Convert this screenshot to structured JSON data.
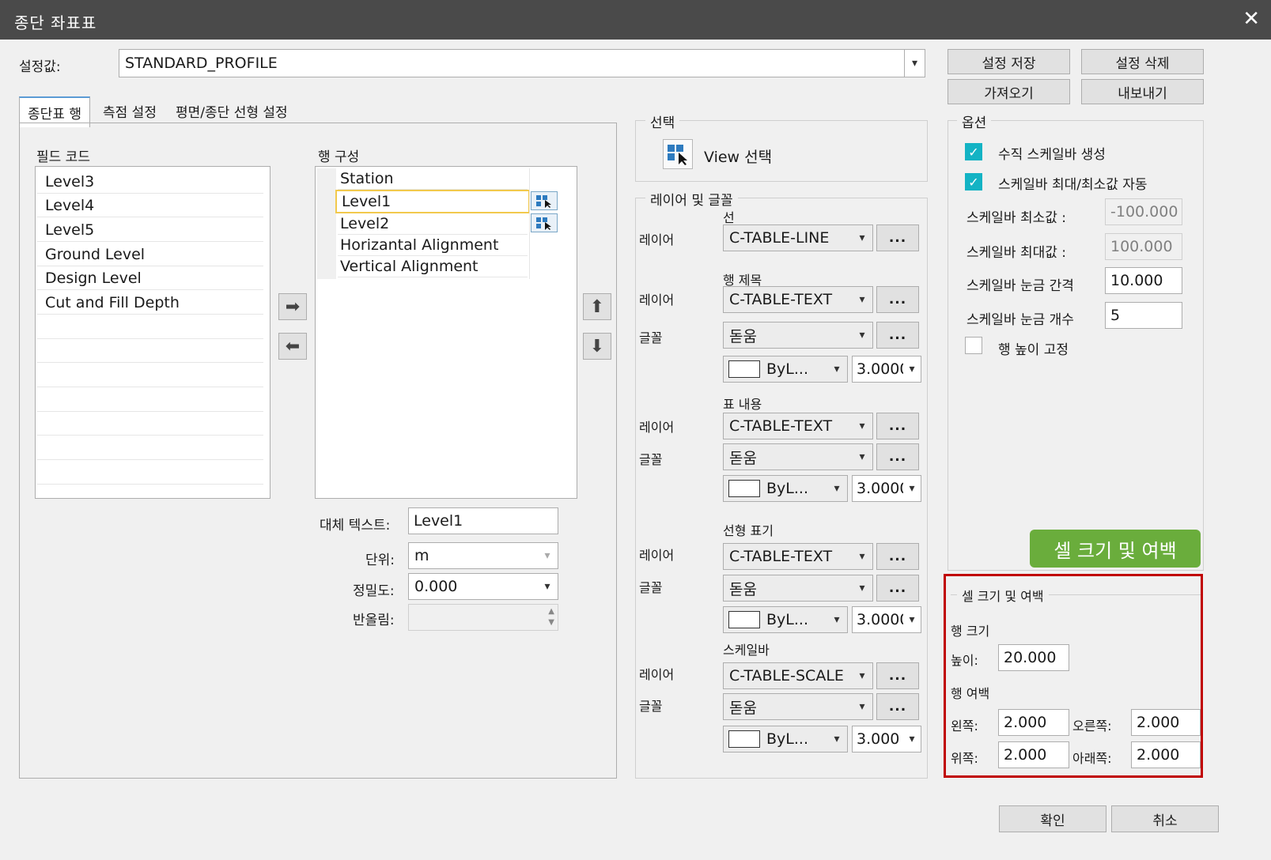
{
  "window": {
    "title": "종단 좌표표",
    "close_glyph": "✕"
  },
  "preset": {
    "label": "설정값:",
    "value": "STANDARD_PROFILE",
    "save": "설정 저장",
    "delete": "설정 삭제",
    "import": "가져오기",
    "export": "내보내기"
  },
  "tabs": [
    "종단표 행",
    "측점 설정",
    "평면/종단 선형 설정"
  ],
  "field_code": {
    "label": "필드 코드",
    "items": [
      "Level3",
      "Level4",
      "Level5",
      "Ground Level",
      "Design Level",
      "Cut and Fill Depth"
    ]
  },
  "row_config": {
    "label": "행 구성",
    "items": [
      "Station",
      "Level1",
      "Level2",
      "Horizantal Alignment",
      "Vertical Alignment"
    ],
    "selected": "Level1"
  },
  "row_props": {
    "alt_text_label": "대체 텍스트:",
    "alt_text": "Level1",
    "unit_label": "단위:",
    "unit": "m",
    "precision_label": "정밀도:",
    "precision": "0.000",
    "rounding_label": "반올림:",
    "rounding": ""
  },
  "selection": {
    "title": "선택",
    "view_button": "View 선택"
  },
  "layer_font": {
    "title": "레이어 및 글꼴",
    "layer_label": "레이어",
    "font_label": "글꼴",
    "more": "...",
    "line": {
      "heading": "선",
      "layer": "C-TABLE-LINE"
    },
    "row_title": {
      "heading": "행 제목",
      "layer": "C-TABLE-TEXT",
      "font": "돋움",
      "color": "ByL...",
      "size": "3.0000"
    },
    "table_content": {
      "heading": "표 내용",
      "layer": "C-TABLE-TEXT",
      "font": "돋움",
      "color": "ByL...",
      "size": "3.0000"
    },
    "alignment": {
      "heading": "선형 표기",
      "layer": "C-TABLE-TEXT",
      "font": "돋움",
      "color": "ByL...",
      "size": "3.0000"
    },
    "scalebar": {
      "heading": "스케일바",
      "layer": "C-TABLE-SCALE",
      "font": "돋움",
      "color": "ByL...",
      "size": "3.000"
    }
  },
  "options": {
    "title": "옵션",
    "vertical_scalebar": {
      "label": "수직 스케일바 생성",
      "checked": true
    },
    "auto_minmax": {
      "label": "스케일바 최대/최소값 자동",
      "checked": true
    },
    "min_label": "스케일바 최소값 :",
    "min_value": "-100.000",
    "max_label": "스케일바 최대값 :",
    "max_value": "100.000",
    "interval_label": "스케일바 눈금 간격",
    "interval_value": "10.000",
    "count_label": "스케일바 눈금 개수",
    "count_value": "5",
    "fix_height": {
      "label": "행 높이 고정",
      "checked": false
    }
  },
  "callout": {
    "text": "셀 크기 및 여백",
    "color": "#6aad3c",
    "border_color": "#c00000"
  },
  "cell_size": {
    "title": "셀 크기 및 여백",
    "row_size_label": "행 크기",
    "height_label": "높이:",
    "height": "20.000",
    "row_margin_label": "행 여백",
    "left_label": "왼쪽:",
    "left": "2.000",
    "right_label": "오른쪽:",
    "right": "2.000",
    "top_label": "위쪽:",
    "top": "2.000",
    "bottom_label": "아래쪽:",
    "bottom": "2.000"
  },
  "footer": {
    "ok": "확인",
    "cancel": "취소"
  }
}
